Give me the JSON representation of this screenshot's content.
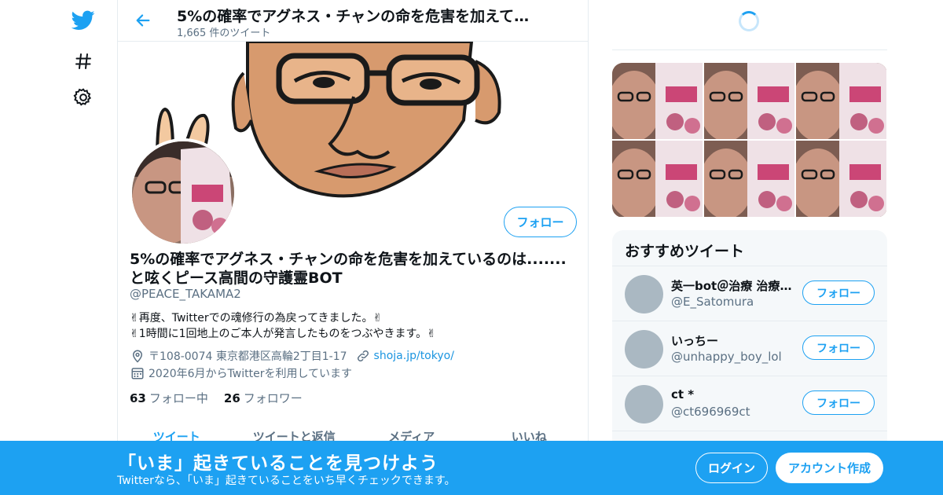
{
  "colors": {
    "accent": "#1da1f2",
    "secondary_text": "#5b7083",
    "bottom_bar": "#1da1f2"
  },
  "nav": {
    "icons": [
      "twitter-bird-icon",
      "hashtag-icon",
      "gear-icon"
    ]
  },
  "header": {
    "title": "5%の確率でアグネス・チャンの命を危害を加えて…",
    "tweet_count": "1,665 件のツイート"
  },
  "profile": {
    "follow_label": "フォロー",
    "display_name": "5%の確率でアグネス・チャンの命を危害を加えているのは.......と呟くピース高間の守護霊BOT",
    "handle": "@PEACE_TAKAMA2",
    "bio_line1": "✌再度、Twitterでの魂修行の為戻ってきました。✌",
    "bio_line2": "✌1時間に1回地上のご本人が発言したものをつぶやきます。✌",
    "location": "〒108-0074 東京都港区高輪2丁目1-17",
    "url": "shoja.jp/tokyo/",
    "joined": "2020年6月からTwitterを利用しています",
    "following_count": "63",
    "following_label": "フォロー中",
    "followers_count": "26",
    "followers_label": "フォロワー"
  },
  "tabs": [
    {
      "label": "ツイート"
    },
    {
      "label": "ツイートと返信"
    },
    {
      "label": "メディア"
    },
    {
      "label": "いいね"
    }
  ],
  "recommended": {
    "title": "おすすめツイート",
    "follow_label": "フォロー",
    "users": [
      {
        "name": "英一bot＠治療 治療 …",
        "handle": "@E_Satomura"
      },
      {
        "name": "いっちー",
        "handle": "@unhappy_boy_lol"
      },
      {
        "name": "ct *",
        "handle": "@ct696969ct"
      }
    ]
  },
  "bottom_bar": {
    "headline": "「いま」起きていることを見つけよう",
    "subtext": "Twitterなら、「いま」起きていることをいち早くチェックできます。",
    "login_label": "ログイン",
    "signup_label": "アカウント作成"
  }
}
